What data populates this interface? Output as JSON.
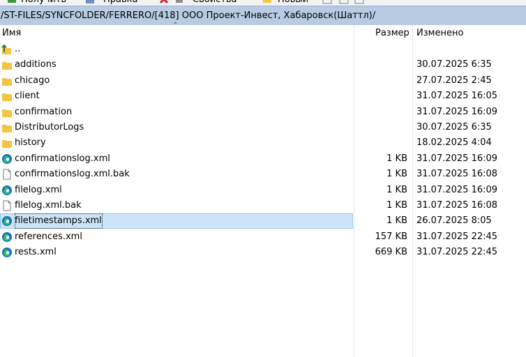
{
  "toolbar": {
    "receive_label": "Получить",
    "edit_label": "Правка",
    "properties_label": "Свойства",
    "new_label": "Новый"
  },
  "path": "/ST-FILES/SYNCFOLDER/FERRERO/[418] ООО Проект-Инвест, Хабаровск(Шаттл)/",
  "columns": {
    "name": "Имя",
    "size": "Размер",
    "modified": "Изменено"
  },
  "rows": [
    {
      "name": "..",
      "size": "",
      "modified": "",
      "icon": "parent-folder-icon"
    },
    {
      "name": "additions",
      "size": "",
      "modified": "30.07.2025 6:35",
      "icon": "folder-icon"
    },
    {
      "name": "chicago",
      "size": "",
      "modified": "27.07.2025 2:45",
      "icon": "folder-icon"
    },
    {
      "name": "client",
      "size": "",
      "modified": "31.07.2025 16:05",
      "icon": "folder-icon"
    },
    {
      "name": "confirmation",
      "size": "",
      "modified": "31.07.2025 16:09",
      "icon": "folder-icon"
    },
    {
      "name": "DistributorLogs",
      "size": "",
      "modified": "30.07.2025 6:35",
      "icon": "folder-icon"
    },
    {
      "name": "history",
      "size": "",
      "modified": "18.02.2025 4:04",
      "icon": "folder-icon"
    },
    {
      "name": "confirmationslog.xml",
      "size": "1 KB",
      "modified": "31.07.2025 16:09",
      "icon": "edge-xml-icon"
    },
    {
      "name": "confirmationslog.xml.bak",
      "size": "1 KB",
      "modified": "31.07.2025 16:08",
      "icon": "blank-file-icon"
    },
    {
      "name": "filelog.xml",
      "size": "1 KB",
      "modified": "31.07.2025 16:09",
      "icon": "edge-xml-icon"
    },
    {
      "name": "filelog.xml.bak",
      "size": "1 KB",
      "modified": "31.07.2025 16:08",
      "icon": "blank-file-icon"
    },
    {
      "name": "filetimestamps.xml",
      "size": "1 KB",
      "modified": "26.07.2025 8:05",
      "icon": "edge-xml-icon",
      "selected": true
    },
    {
      "name": "references.xml",
      "size": "157 KB",
      "modified": "31.07.2025 22:45",
      "icon": "edge-xml-icon"
    },
    {
      "name": "rests.xml",
      "size": "669 KB",
      "modified": "31.07.2025 22:45",
      "icon": "edge-xml-icon"
    }
  ],
  "colors": {
    "path_bar": "#b8cbe3",
    "selection": "#cce4f7",
    "selection_border": "#99c9ef",
    "folder": "#f4c542",
    "edge_blue": "#0c72d1",
    "edge_green": "#35c15a"
  }
}
